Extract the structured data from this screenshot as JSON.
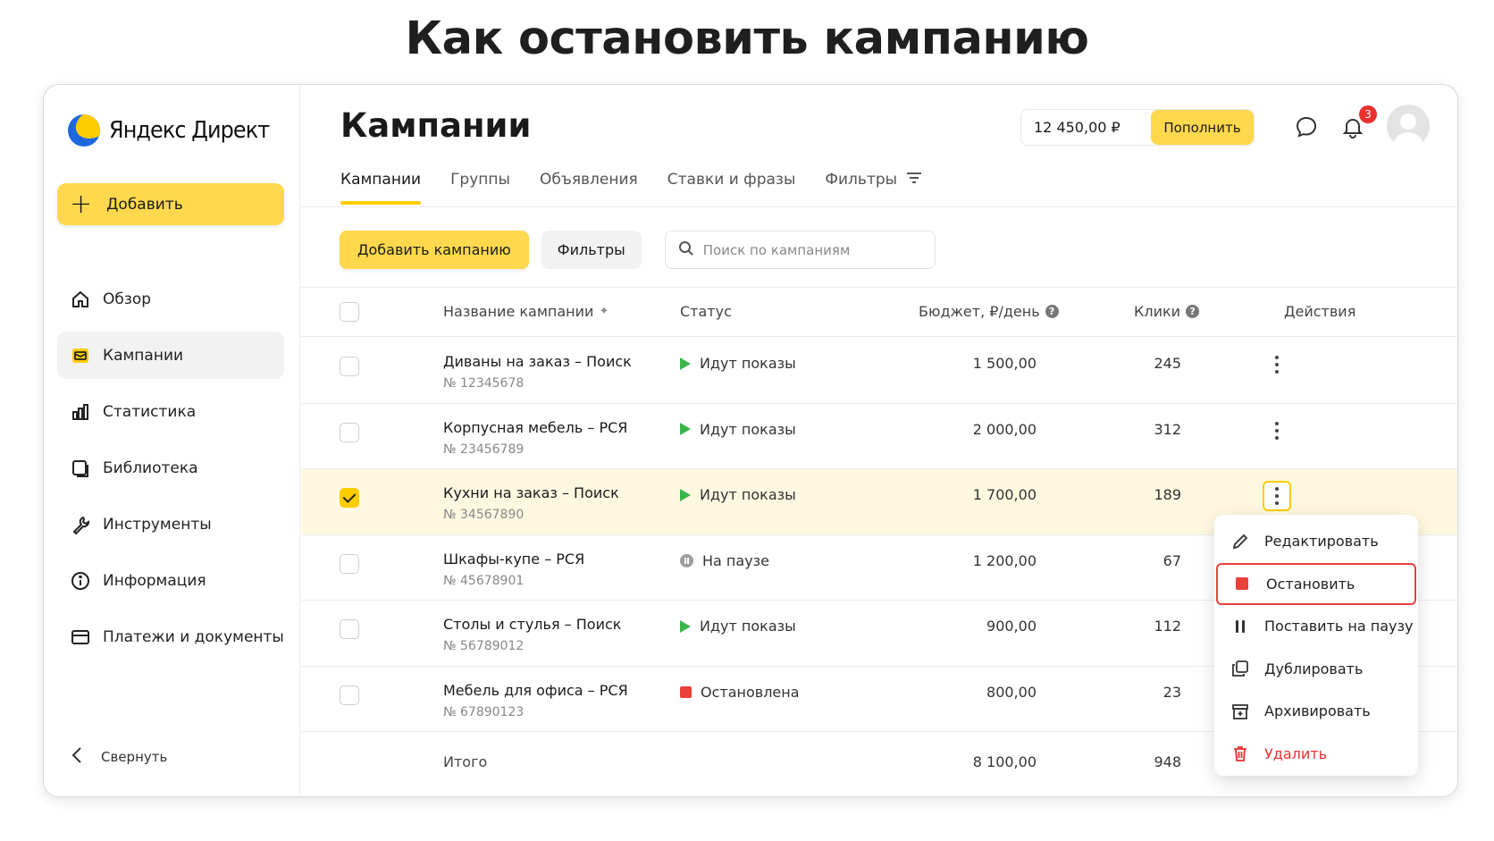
{
  "headline": "Как остановить кампанию",
  "app": {
    "logo_text": "Яндекс Директ"
  },
  "sidebar": {
    "add_label": "Добавить",
    "items": [
      {
        "label": "Обзор",
        "icon": "home-icon"
      },
      {
        "label": "Кампании",
        "icon": "campaigns-icon",
        "active": true
      },
      {
        "label": "Статистика",
        "icon": "stats-icon"
      },
      {
        "label": "Библиотека",
        "icon": "library-icon"
      },
      {
        "label": "Инструменты",
        "icon": "wrench-icon"
      },
      {
        "label": "Информация",
        "icon": "info-icon"
      },
      {
        "label": "Платежи и документы",
        "icon": "card-icon"
      }
    ],
    "collapse_label": "Свернуть"
  },
  "header": {
    "title": "Кампании",
    "balance": "12 450,00 ₽",
    "topup_label": "Пополнить",
    "notifications_count": "3"
  },
  "tabs": [
    "Кампании",
    "Группы",
    "Объявления",
    "Ставки и фразы",
    "Фильтры"
  ],
  "toolbar": {
    "add_campaign": "Добавить кампанию",
    "filters": "Фильтры",
    "search_placeholder": "Поиск по кампаниям"
  },
  "table": {
    "headers": {
      "name": "Название кампании",
      "status": "Статус",
      "budget": "Бюджет, ₽/день",
      "clicks": "Клики",
      "actions": "Действия"
    },
    "rows": [
      {
        "name": "Диваны на заказ – Поиск",
        "num": "№ 12345678",
        "status": "Идут показы",
        "status_type": "active",
        "budget": "1 500,00",
        "clicks": "245",
        "selected": false
      },
      {
        "name": "Корпусная мебель – РСЯ",
        "num": "№ 23456789",
        "status": "Идут показы",
        "status_type": "active",
        "budget": "2 000,00",
        "clicks": "312",
        "selected": false
      },
      {
        "name": "Кухни на заказ – Поиск",
        "num": "№ 34567890",
        "status": "Идут показы",
        "status_type": "active",
        "budget": "1 700,00",
        "clicks": "189",
        "selected": true
      },
      {
        "name": "Шкафы-купе – РСЯ",
        "num": "№ 45678901",
        "status": "На паузе",
        "status_type": "paused",
        "budget": "1 200,00",
        "clicks": "67",
        "selected": false
      },
      {
        "name": "Столы и стулья – Поиск",
        "num": "№ 56789012",
        "status": "Идут показы",
        "status_type": "active",
        "budget": "900,00",
        "clicks": "112",
        "selected": false
      },
      {
        "name": "Мебель для офиса – РСЯ",
        "num": "№ 67890123",
        "status": "Остановлена",
        "status_type": "stopped",
        "budget": "800,00",
        "clicks": "23",
        "selected": false
      }
    ],
    "total": {
      "label": "Итого",
      "budget": "8 100,00",
      "clicks": "948"
    }
  },
  "menu": {
    "items": [
      {
        "label": "Редактировать",
        "icon": "pencil-icon"
      },
      {
        "label": "Остановить",
        "icon": "stop-icon",
        "highlighted": true
      },
      {
        "label": "Поставить на паузу",
        "icon": "pause-icon"
      },
      {
        "label": "Дублировать",
        "icon": "duplicate-icon"
      },
      {
        "label": "Архивировать",
        "icon": "archive-icon"
      },
      {
        "label": "Удалить",
        "icon": "trash-icon",
        "danger": true
      }
    ]
  },
  "colors": {
    "accent": "#ffd84d",
    "selected_row": "#fff8e1",
    "danger": "#e8302e",
    "status_active": "#3bb54a"
  }
}
